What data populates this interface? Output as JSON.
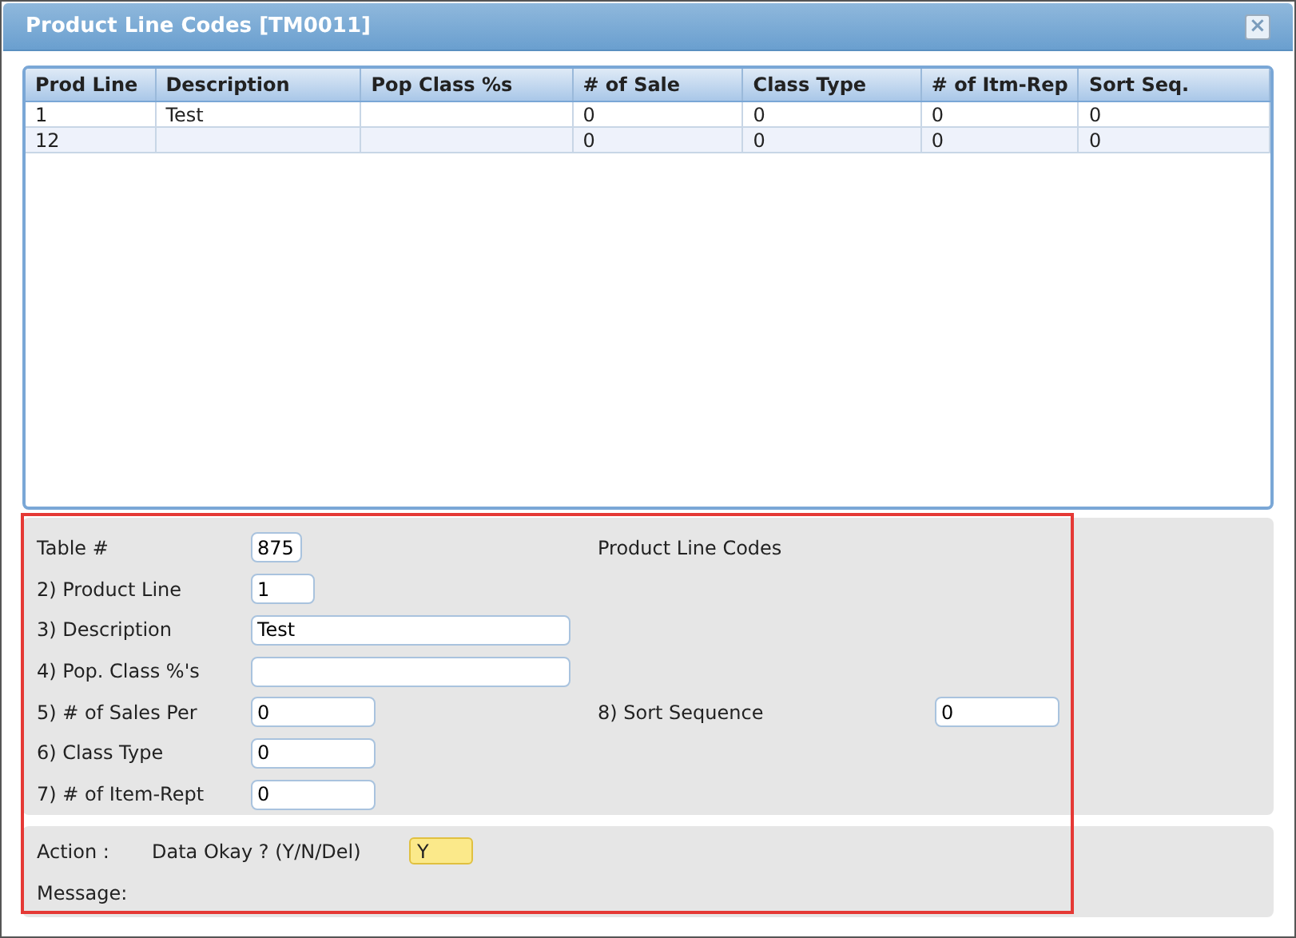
{
  "window": {
    "title": "Product Line Codes [TM0011]",
    "close": "×"
  },
  "table": {
    "columns": [
      "Prod Line",
      "Description",
      "Pop Class %s",
      "# of Sale",
      "Class Type",
      "# of Itm-Rep",
      "Sort Seq."
    ],
    "rows": [
      [
        "1",
        "Test",
        "",
        "0",
        "0",
        "0",
        "0"
      ],
      [
        "12",
        "",
        "",
        "0",
        "0",
        "0",
        "0"
      ]
    ]
  },
  "form": {
    "rows": [
      {
        "label": "Table #",
        "value": "875",
        "kind": "tiny",
        "right_text": "Product Line Codes"
      },
      {
        "label": "2) Product Line",
        "value": "1",
        "kind": "short"
      },
      {
        "label": "3) Description",
        "value": "Test",
        "kind": "wide"
      },
      {
        "label": "4) Pop. Class %'s",
        "value": "",
        "kind": "wide"
      },
      {
        "label": "5) # of Sales Per",
        "value": "0",
        "kind": "medium",
        "right_label": "8) Sort Sequence",
        "right_value": "0"
      },
      {
        "label": "6) Class Type",
        "value": "0",
        "kind": "medium"
      },
      {
        "label": "7) # of Item-Rept",
        "value": "0",
        "kind": "medium"
      }
    ]
  },
  "action": {
    "label": "Action :",
    "prompt": "Data Okay ? (Y/N/Del)",
    "value": "Y",
    "message_label": "Message:"
  }
}
